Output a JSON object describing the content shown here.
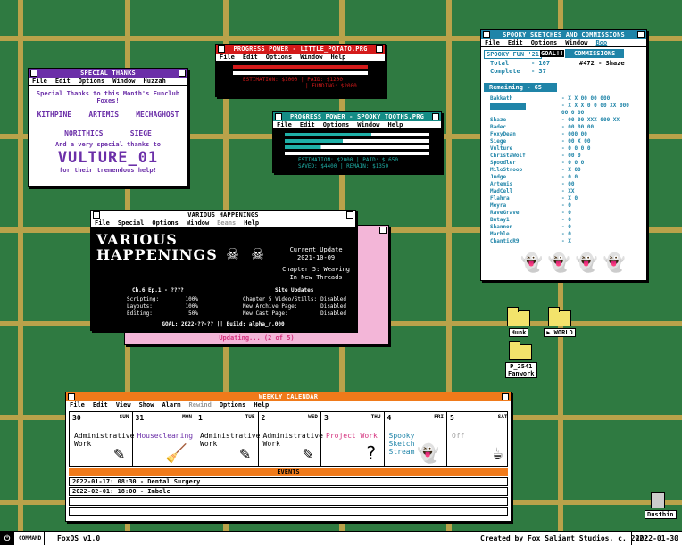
{
  "thanks": {
    "title": "SPECIAL THANKS",
    "menu": [
      "File",
      "Edit",
      "Options",
      "Window",
      "Huzzah"
    ],
    "line1": "Special Thanks to this Month's Funclub Foxes!",
    "names_row1": [
      "KITHPINE",
      "ARTEMIS",
      "MECHAGHOST"
    ],
    "names_row2": [
      "NORITHICS",
      "SIEGE"
    ],
    "line2": "And a very special thanks to",
    "big": "VULTURE_01",
    "line3": "for their tremendous help!"
  },
  "potato": {
    "title": "PROGRESS POWER - LITTLE_POTATO.PRG",
    "menu": [
      "File",
      "Edit",
      "Options",
      "Window",
      "Help"
    ],
    "est": "ESTIMATION: $1000 | PAID:        $1200",
    "fund": "| FUNDING:      $2000"
  },
  "toothe": {
    "title": "PROGRESS POWER - SPOOKY_TOOTHS.PRG",
    "menu": [
      "File",
      "Edit",
      "Options",
      "Window",
      "Help"
    ],
    "est": "ESTIMATION: $2000 | PAID:        $ 650",
    "saved": "SAVED:       $4400 | REMAIN:     $1350"
  },
  "spooky": {
    "title": "SPOOKY SKETCHES AND COMMISSIONS",
    "menu": [
      "File",
      "Edit",
      "Options",
      "Window",
      "Boo"
    ],
    "fun": "SPOOKY FUN '21",
    "goal": "GOAL!!",
    "comm": "COMMISSIONS",
    "total_l": "Total",
    "total_v": "- 107",
    "complete_l": "Complete",
    "complete_v": "- 37",
    "next": "#472 - Shaze",
    "remaining": "Remaining - 65",
    "rows": [
      [
        "Bakkath",
        "- X X 00 00 000"
      ],
      [
        "",
        "- X X X 0 0 00 XX 000"
      ],
      [
        "",
        "00 0 00"
      ],
      [
        "Shaze",
        "- 00 00 XXX 000 XX"
      ],
      [
        "Badec",
        "- 00 00 00"
      ],
      [
        "FoxyDean",
        "- 000 00"
      ],
      [
        "Siege",
        "- 00 X 00"
      ],
      [
        "Vulture",
        "- 0 0 0 0"
      ],
      [
        "ChristaWolf",
        "- 00 0"
      ],
      [
        "Spoodler",
        "- 0 0 0"
      ],
      [
        "MiloStroop",
        "- X 00"
      ],
      [
        "Judge",
        "- 0 0"
      ],
      [
        "Artemis",
        "- 00"
      ],
      [
        "MadCell",
        "- XX"
      ],
      [
        "Flahra",
        "- X 0"
      ],
      [
        "Meyra",
        "- 0"
      ],
      [
        "RaveGrave",
        "- 0"
      ],
      [
        "Butay1",
        "- 0"
      ],
      [
        "Shannon",
        "- 0"
      ],
      [
        "Marble",
        "- 0"
      ],
      [
        "ChanticR9",
        "- X"
      ]
    ]
  },
  "happen": {
    "title": "VARIOUS HAPPENINGS",
    "menu": [
      "File",
      "Special",
      "Options",
      "Window",
      "Beans",
      "Help"
    ],
    "logo1": "VARIOUS",
    "logo2": "HAPPENINGS",
    "cu": "Current Update",
    "cu_date": "2021-10-09",
    "chap": "Chapter 5: Weaving",
    "chap2": "In New Threads",
    "ep": "Ch.6 Ep.1 - ????",
    "site": "Site Updates",
    "stats": [
      [
        "Scripting:",
        "100%"
      ],
      [
        "Layouts:",
        "100%"
      ],
      [
        "Editing:",
        "50%"
      ]
    ],
    "site_rows": [
      [
        "Chapter 5 Video/Stills:",
        "Disabled"
      ],
      [
        "New Archive Page:",
        "Disabled"
      ],
      [
        "New Cast Page:",
        "Disabled"
      ]
    ],
    "goal": "GOAL: 2022-??-?? || Build: alpha_r.000"
  },
  "updating": "Updating... (2 of 5)",
  "icons": {
    "hunk": "Hunk",
    "world": "▶ WORLD",
    "p2541": "P_2541",
    "fanwork": "Fanwork",
    "dustbin": "Dustbin"
  },
  "calendar": {
    "title": "WEEKLY CALENDAR",
    "menu": [
      "File",
      "Edit",
      "View",
      "Show",
      "Alarm",
      "Rewind",
      "Options",
      "Help"
    ],
    "days": [
      {
        "num": "30",
        "dow": "SUN",
        "ev": "Administrative Work",
        "color": "#000",
        "icon": "✎"
      },
      {
        "num": "31",
        "dow": "MON",
        "ev": "Housecleaning",
        "color": "#6b2fa8",
        "icon": "🧹"
      },
      {
        "num": "1",
        "dow": "TUE",
        "ev": "Administrative Work",
        "color": "#000",
        "icon": "✎"
      },
      {
        "num": "2",
        "dow": "WED",
        "ev": "Administrative Work",
        "color": "#000",
        "icon": "✎"
      },
      {
        "num": "3",
        "dow": "THU",
        "ev": "Project Work",
        "color": "#d4317d",
        "icon": "?"
      },
      {
        "num": "4",
        "dow": "FRI",
        "ev": "Spooky Sketch Stream",
        "color": "#1f84a8",
        "icon": "👻"
      },
      {
        "num": "5",
        "dow": "SAT",
        "ev": "Off",
        "color": "#9a9a9a",
        "icon": "☕"
      }
    ],
    "events_title": "EVENTS",
    "events": [
      "2022-01-17: 08:30 - Dental Surgery",
      "2022-02-01: 18:00 - Imbolc",
      "",
      ""
    ]
  },
  "taskbar": {
    "command": "COMMAND",
    "os": "FoxOS v1.0",
    "credit": "Created by Fox Saliant Studios, c. 2022",
    "date": "2022-01-30"
  }
}
